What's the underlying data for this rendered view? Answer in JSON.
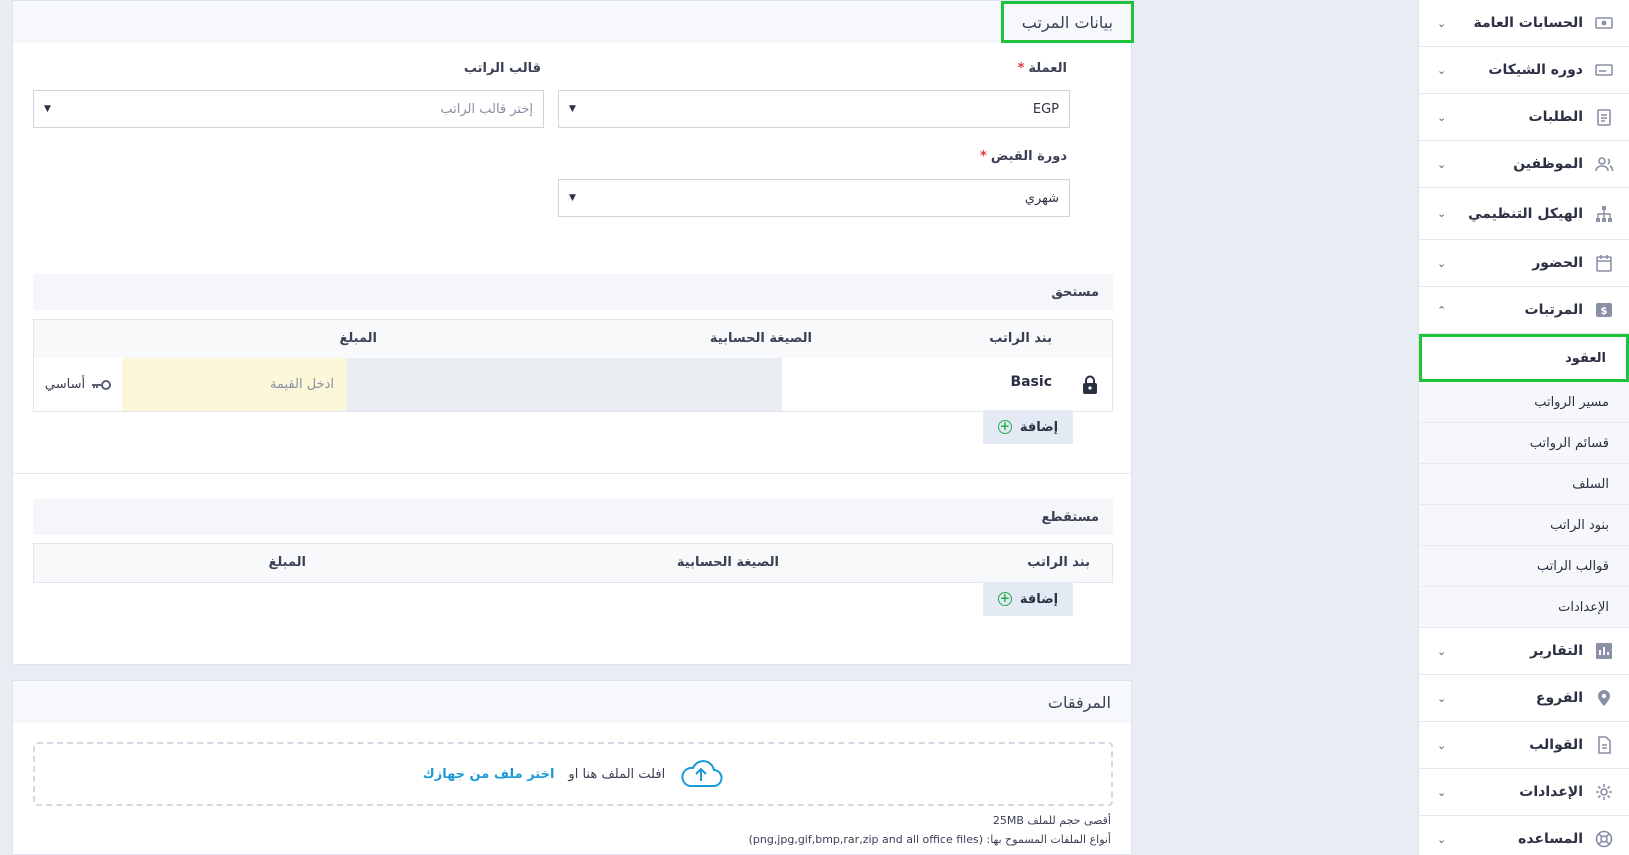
{
  "sidebar": {
    "items": [
      {
        "label": "الحسابات العامة",
        "icon": "money-icon"
      },
      {
        "label": "دوره الشيكات",
        "icon": "check-card-icon"
      },
      {
        "label": "الطلبات",
        "icon": "clipboard-icon"
      },
      {
        "label": "الموظفين",
        "icon": "users-icon"
      },
      {
        "label": "الهيكل التنظيمي",
        "icon": "org-chart-icon"
      },
      {
        "label": "الحضور",
        "icon": "calendar-icon"
      },
      {
        "label": "المرتبات",
        "icon": "dollar-icon"
      }
    ],
    "submenu": [
      {
        "label": "العقود"
      },
      {
        "label": "مسير الرواتب"
      },
      {
        "label": "قسائم الرواتب"
      },
      {
        "label": "السلف"
      },
      {
        "label": "بنود الراتب"
      },
      {
        "label": "قوالب الراتب"
      },
      {
        "label": "الإعدادات"
      }
    ],
    "items_after": [
      {
        "label": "التقارير",
        "icon": "bar-chart-icon"
      },
      {
        "label": "الفروع",
        "icon": "map-pin-icon"
      },
      {
        "label": "القوالب",
        "icon": "document-icon"
      },
      {
        "label": "الإعدادات",
        "icon": "gear-icon"
      },
      {
        "label": "المساعده",
        "icon": "lifebuoy-icon"
      }
    ]
  },
  "salary_card": {
    "title": "بيانات المرتب",
    "currency_label": "العملة",
    "currency_required": "*",
    "currency_value": "EGP",
    "template_label": "قالب الراتب",
    "template_placeholder": "إختر قالب الراتب",
    "pay_cycle_label": "دورة القبض",
    "pay_cycle_required": "*",
    "pay_cycle_value": "شهري"
  },
  "earnings": {
    "title": "مستحق",
    "col_item": "بند الراتب",
    "col_formula": "الصيغة الحسابية",
    "col_amount": "المبلغ",
    "row_item": "Basic",
    "row_amount_placeholder": "ادخل القيمة",
    "row_key_label": "أساسي",
    "add_label": "إضافة"
  },
  "deductions": {
    "title": "مستقطع",
    "col_item": "بند الراتب",
    "col_formula": "الصيغة الحسابية",
    "col_amount": "المبلغ",
    "add_label": "إضافة"
  },
  "attachments": {
    "title": "المرفقات",
    "drop_text": "افلت الملف هنا او",
    "choose_link": "اختر ملف من جهازك",
    "max_size": "أقصى حجم للملف 25MB",
    "allowed_types": "أنواع الملفات المسموح بها: (png,jpg,gif,bmp,rar,zip and all office files)"
  }
}
